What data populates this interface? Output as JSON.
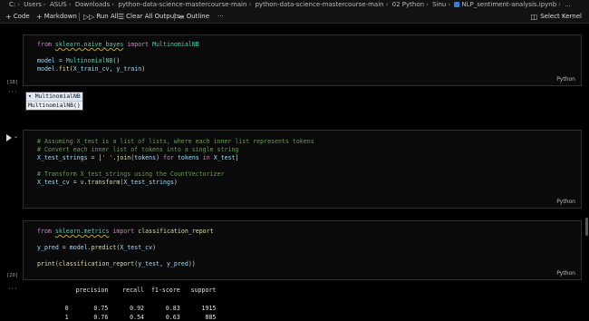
{
  "breadcrumb": [
    "C:",
    "Users",
    "ASUS",
    "Downloads",
    "python-data-science-mastercourse-main",
    "python-data-science-mastercourse-main",
    "02 Python",
    "Sinu",
    "NLP_sentiment-analysis.ipynb",
    "..."
  ],
  "toolbar": {
    "code": "Code",
    "markdown": "Markdown",
    "run_all": "Run All",
    "clear_all": "Clear All Outputs",
    "outline": "Outline",
    "more": "···",
    "kernel": "Select Kernel"
  },
  "cells": {
    "c1": {
      "count": "[18]",
      "lang": "Python"
    },
    "c1_out": {
      "dots": "···",
      "head": "▾ MultinomialNB",
      "body": "MultinomialNB()"
    },
    "c2": {
      "lang": "Python"
    },
    "c3": {
      "count": "[20]",
      "lang": "Python"
    },
    "c3_out": {
      "dots": "···"
    }
  },
  "code": {
    "c1": {
      "from": "from",
      "mod": "sklearn.naive_bayes",
      "import": "import",
      "cls": "MultinomialNB",
      "l2_var": "model",
      "l2_eq": " = ",
      "l2_cls": "MultinomialNB",
      "l2_par": "()",
      "l3_var": "model",
      "l3_dot": ".",
      "l3_fn": "fit",
      "l3_open": "(",
      "l3_a": "X_train_cv",
      "l3_comma": ", ",
      "l3_b": "y_train",
      "l3_close": ")"
    },
    "c2": {
      "cm1": "# Assuming X_test is a list of lists, where each inner list represents tokens",
      "cm2": "# Convert each inner list of tokens into a single string",
      "l3_var": "X_test_strings",
      "l3_a": " = [",
      "l3_str": "' '",
      "l3_b": ".",
      "l3_fn": "join",
      "l3_c": "(",
      "l3_v1": "tokens",
      "l3_d": ") ",
      "l3_kw1": "for",
      "l3_e": " ",
      "l3_v2": "tokens",
      "l3_f": " ",
      "l3_kw2": "in",
      "l3_g": " ",
      "l3_v3": "X_test",
      "l3_h": "]",
      "cm3": "# Transform X_test_strings using the CountVectorizer",
      "l5_var": "X_test_cv",
      "l5_a": " = ",
      "l5_v": "v",
      "l5_b": ".",
      "l5_fn": "transform",
      "l5_c": "(",
      "l5_arg": "X_test_strings",
      "l5_d": ")"
    },
    "c3": {
      "from": "from",
      "mod": "sklearn.metrics",
      "import": "import",
      "fn": "classification_report",
      "l2_var": "y_pred",
      "l2_a": " = ",
      "l2_v": "model",
      "l2_b": ".",
      "l2_fn": "predict",
      "l2_c": "(",
      "l2_arg": "X_test_cv",
      "l2_d": ")",
      "l3_fn": "print",
      "l3_a": "(",
      "l3_fn2": "classification_report",
      "l3_b": "(",
      "l3_v1": "y_test",
      "l3_c": ", ",
      "l3_v2": "y_pred",
      "l3_d": "))"
    }
  },
  "report": {
    "header": "              precision    recall  f1-score   support",
    "rows": [
      "           0       0.75      0.92      0.83      1915",
      "           1       0.76      0.54      0.63       885"
    ]
  }
}
